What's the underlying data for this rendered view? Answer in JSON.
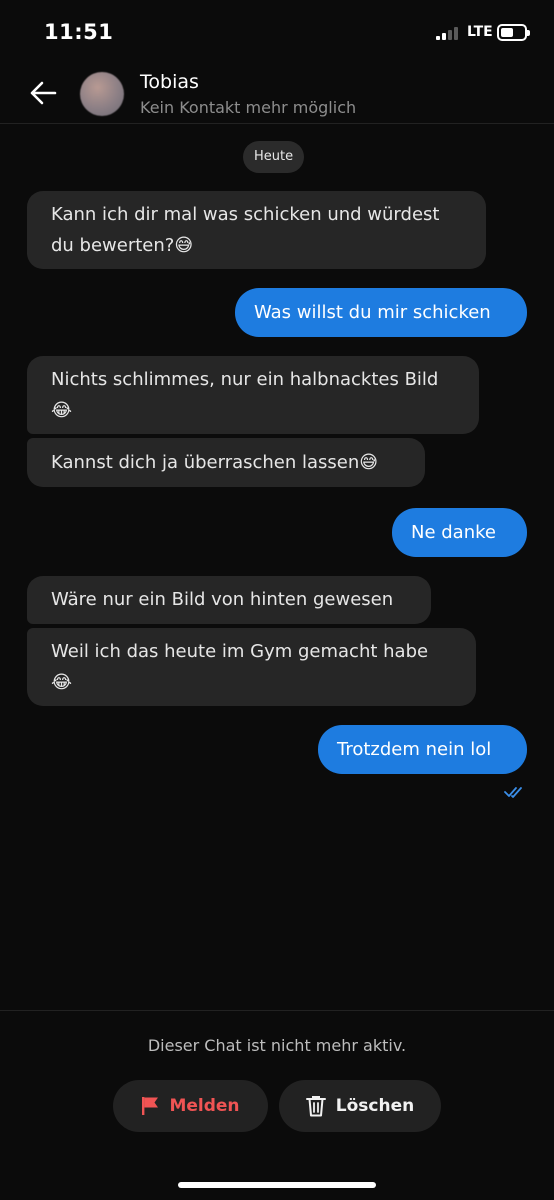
{
  "status_bar": {
    "time": "11:51",
    "network": "LTE",
    "signal_bars": 2,
    "signal_total": 4,
    "battery_level": 0.4
  },
  "header": {
    "back_icon": "arrow-left-icon",
    "name": "Tobias",
    "subtitle": "Kein Kontakt mehr möglich"
  },
  "date_chip": "Heute",
  "messages": [
    {
      "side": "in",
      "lines": [
        "Kann ich dir mal was schicken und würdest",
        "du bewerten?😅"
      ]
    },
    {
      "side": "out",
      "lines": [
        "Was willst du mir schicken"
      ]
    },
    {
      "side": "in",
      "lines": [
        "Nichts schlimmes, nur ein halbnacktes Bild",
        "😂"
      ]
    },
    {
      "side": "in",
      "lines": [
        "Kannst dich ja überraschen lassen😅"
      ]
    },
    {
      "side": "out",
      "lines": [
        "Ne danke"
      ]
    },
    {
      "side": "in",
      "lines": [
        "Wäre nur ein Bild von hinten gewesen"
      ]
    },
    {
      "side": "in",
      "lines": [
        "Weil ich das heute im Gym gemacht habe",
        "😂"
      ]
    },
    {
      "side": "out",
      "lines": [
        "Trotzdem nein lol"
      ]
    }
  ],
  "read_receipt_icon": "double-check-icon",
  "footer": {
    "inactive_text": "Dieser Chat ist nicht mehr aktiv.",
    "report_label": "Melden",
    "report_icon": "flag-icon",
    "delete_label": "Löschen",
    "delete_icon": "trash-icon"
  },
  "colors": {
    "accent": "#1e7ce0",
    "incoming_bubble": "#262626",
    "report": "#f05454",
    "background": "#0b0b0b"
  }
}
